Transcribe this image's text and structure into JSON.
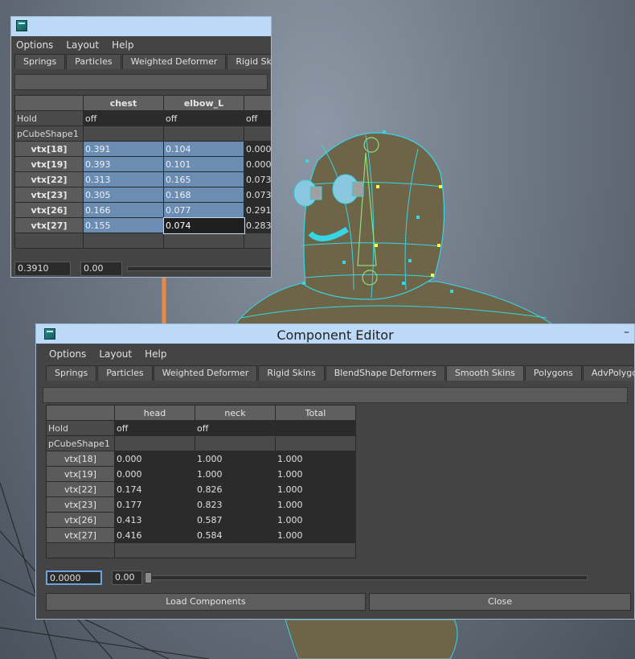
{
  "small_window": {
    "menu": [
      "Options",
      "Layout",
      "Help"
    ],
    "tabs": [
      "Springs",
      "Particles",
      "Weighted Deformer",
      "Rigid Skins"
    ],
    "columns": [
      "chest",
      "elbow_L",
      ""
    ],
    "hold_row": {
      "label": "Hold",
      "values": [
        "off",
        "off",
        "off"
      ]
    },
    "shape_label": "pCubeShape1",
    "rows": [
      {
        "vtx": "vtx[18]",
        "values": [
          "0.391",
          "0.104",
          "0.000"
        ]
      },
      {
        "vtx": "vtx[19]",
        "values": [
          "0.393",
          "0.101",
          "0.000"
        ]
      },
      {
        "vtx": "vtx[22]",
        "values": [
          "0.313",
          "0.165",
          "0.073"
        ]
      },
      {
        "vtx": "vtx[23]",
        "values": [
          "0.305",
          "0.168",
          "0.073"
        ]
      },
      {
        "vtx": "vtx[26]",
        "values": [
          "0.166",
          "0.077",
          "0.291"
        ]
      },
      {
        "vtx": "vtx[27]",
        "values": [
          "0.155",
          "0.074",
          "0.283"
        ]
      }
    ],
    "value_field": "0.3910",
    "slider_value": "0.00"
  },
  "main_window": {
    "title": "Component Editor",
    "minimize": "–",
    "menu": [
      "Options",
      "Layout",
      "Help"
    ],
    "tabs": [
      "Springs",
      "Particles",
      "Weighted Deformer",
      "Rigid Skins",
      "BlendShape Deformers",
      "Smooth Skins",
      "Polygons",
      "AdvPolygons"
    ],
    "active_tab": "Smooth Skins",
    "columns": [
      "head",
      "neck",
      "Total"
    ],
    "hold_row": {
      "label": "Hold",
      "values": [
        "off",
        "off",
        ""
      ]
    },
    "shape_label": "pCubeShape1",
    "rows": [
      {
        "vtx": "vtx[18]",
        "values": [
          "0.000",
          "1.000",
          "1.000"
        ]
      },
      {
        "vtx": "vtx[19]",
        "values": [
          "0.000",
          "1.000",
          "1.000"
        ]
      },
      {
        "vtx": "vtx[22]",
        "values": [
          "0.174",
          "0.826",
          "1.000"
        ]
      },
      {
        "vtx": "vtx[23]",
        "values": [
          "0.177",
          "0.823",
          "1.000"
        ]
      },
      {
        "vtx": "vtx[26]",
        "values": [
          "0.413",
          "0.587",
          "1.000"
        ]
      },
      {
        "vtx": "vtx[27]",
        "values": [
          "0.416",
          "0.584",
          "1.000"
        ]
      }
    ],
    "value_field": "0.0000",
    "slider_value": "0.00",
    "buttons": {
      "load": "Load Components",
      "close": "Close"
    }
  },
  "colors": {
    "accent_arrow": "#e8894a",
    "mesh_wire": "#35d6e6",
    "title_bar": "#bcd9f7"
  }
}
